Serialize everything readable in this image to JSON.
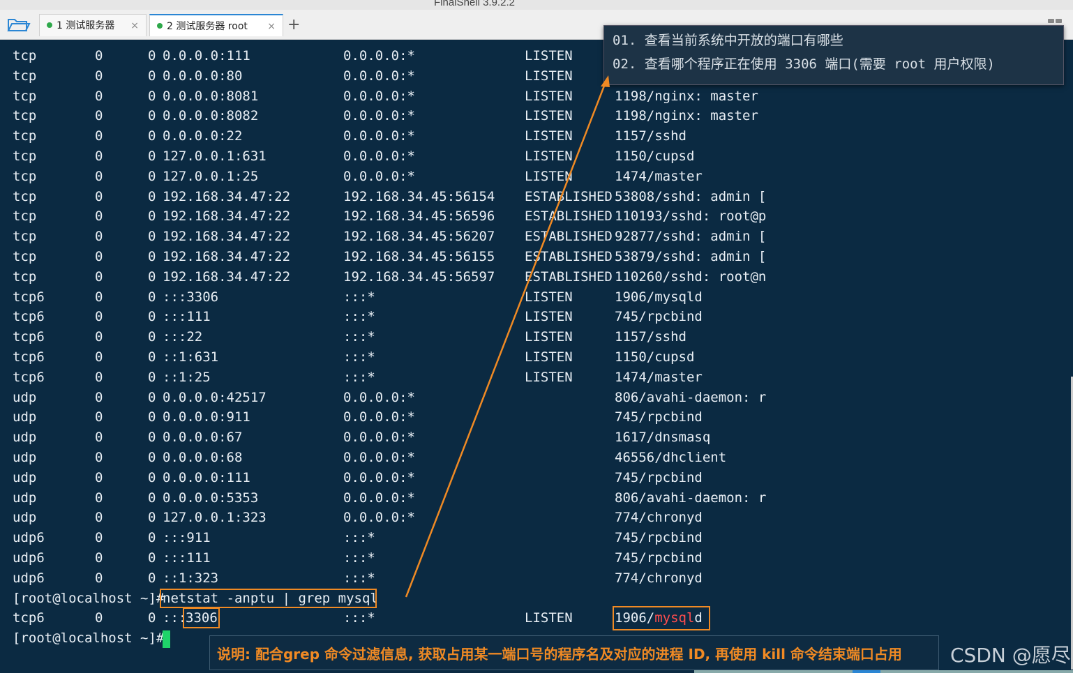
{
  "app": {
    "title": "FinalShell 3.9.2.2"
  },
  "tabs": [
    {
      "label": "1  测试服务器",
      "close": "×"
    },
    {
      "label": "2  测试服务器 root",
      "close": "×"
    }
  ],
  "add_tab": "+",
  "rows": [
    {
      "proto": "tcp",
      "recv": "0",
      "send": "0",
      "local": "0.0.0.0:111",
      "foreign": "0.0.0.0:*",
      "state": "LISTEN",
      "program": ""
    },
    {
      "proto": "tcp",
      "recv": "0",
      "send": "0",
      "local": "0.0.0.0:80",
      "foreign": "0.0.0.0:*",
      "state": "LISTEN",
      "program": ""
    },
    {
      "proto": "tcp",
      "recv": "0",
      "send": "0",
      "local": "0.0.0.0:8081",
      "foreign": "0.0.0.0:*",
      "state": "LISTEN",
      "program": "1198/nginx: master"
    },
    {
      "proto": "tcp",
      "recv": "0",
      "send": "0",
      "local": "0.0.0.0:8082",
      "foreign": "0.0.0.0:*",
      "state": "LISTEN",
      "program": "1198/nginx: master"
    },
    {
      "proto": "tcp",
      "recv": "0",
      "send": "0",
      "local": "0.0.0.0:22",
      "foreign": "0.0.0.0:*",
      "state": "LISTEN",
      "program": "1157/sshd"
    },
    {
      "proto": "tcp",
      "recv": "0",
      "send": "0",
      "local": "127.0.0.1:631",
      "foreign": "0.0.0.0:*",
      "state": "LISTEN",
      "program": "1150/cupsd"
    },
    {
      "proto": "tcp",
      "recv": "0",
      "send": "0",
      "local": "127.0.0.1:25",
      "foreign": "0.0.0.0:*",
      "state": "LISTEN",
      "program": "1474/master"
    },
    {
      "proto": "tcp",
      "recv": "0",
      "send": "0",
      "local": "192.168.34.47:22",
      "foreign": "192.168.34.45:56154",
      "state": "ESTABLISHED",
      "program": "53808/sshd: admin ["
    },
    {
      "proto": "tcp",
      "recv": "0",
      "send": "0",
      "local": "192.168.34.47:22",
      "foreign": "192.168.34.45:56596",
      "state": "ESTABLISHED",
      "program": "110193/sshd: root@p"
    },
    {
      "proto": "tcp",
      "recv": "0",
      "send": "0",
      "local": "192.168.34.47:22",
      "foreign": "192.168.34.45:56207",
      "state": "ESTABLISHED",
      "program": "92877/sshd: admin ["
    },
    {
      "proto": "tcp",
      "recv": "0",
      "send": "0",
      "local": "192.168.34.47:22",
      "foreign": "192.168.34.45:56155",
      "state": "ESTABLISHED",
      "program": "53879/sshd: admin ["
    },
    {
      "proto": "tcp",
      "recv": "0",
      "send": "0",
      "local": "192.168.34.47:22",
      "foreign": "192.168.34.45:56597",
      "state": "ESTABLISHED",
      "program": "110260/sshd: root@n"
    },
    {
      "proto": "tcp6",
      "recv": "0",
      "send": "0",
      "local": ":::3306",
      "foreign": ":::*",
      "state": "LISTEN",
      "program": "1906/mysqld"
    },
    {
      "proto": "tcp6",
      "recv": "0",
      "send": "0",
      "local": ":::111",
      "foreign": ":::*",
      "state": "LISTEN",
      "program": "745/rpcbind"
    },
    {
      "proto": "tcp6",
      "recv": "0",
      "send": "0",
      "local": ":::22",
      "foreign": ":::*",
      "state": "LISTEN",
      "program": "1157/sshd"
    },
    {
      "proto": "tcp6",
      "recv": "0",
      "send": "0",
      "local": "::1:631",
      "foreign": ":::*",
      "state": "LISTEN",
      "program": "1150/cupsd"
    },
    {
      "proto": "tcp6",
      "recv": "0",
      "send": "0",
      "local": "::1:25",
      "foreign": ":::*",
      "state": "LISTEN",
      "program": "1474/master"
    },
    {
      "proto": "udp",
      "recv": "0",
      "send": "0",
      "local": "0.0.0.0:42517",
      "foreign": "0.0.0.0:*",
      "state": "",
      "program": "806/avahi-daemon: r"
    },
    {
      "proto": "udp",
      "recv": "0",
      "send": "0",
      "local": "0.0.0.0:911",
      "foreign": "0.0.0.0:*",
      "state": "",
      "program": "745/rpcbind"
    },
    {
      "proto": "udp",
      "recv": "0",
      "send": "0",
      "local": "0.0.0.0:67",
      "foreign": "0.0.0.0:*",
      "state": "",
      "program": "1617/dnsmasq"
    },
    {
      "proto": "udp",
      "recv": "0",
      "send": "0",
      "local": "0.0.0.0:68",
      "foreign": "0.0.0.0:*",
      "state": "",
      "program": "46556/dhclient"
    },
    {
      "proto": "udp",
      "recv": "0",
      "send": "0",
      "local": "0.0.0.0:111",
      "foreign": "0.0.0.0:*",
      "state": "",
      "program": "745/rpcbind"
    },
    {
      "proto": "udp",
      "recv": "0",
      "send": "0",
      "local": "0.0.0.0:5353",
      "foreign": "0.0.0.0:*",
      "state": "",
      "program": "806/avahi-daemon: r"
    },
    {
      "proto": "udp",
      "recv": "0",
      "send": "0",
      "local": "127.0.0.1:323",
      "foreign": "0.0.0.0:*",
      "state": "",
      "program": "774/chronyd"
    },
    {
      "proto": "udp6",
      "recv": "0",
      "send": "0",
      "local": ":::911",
      "foreign": ":::*",
      "state": "",
      "program": "745/rpcbind"
    },
    {
      "proto": "udp6",
      "recv": "0",
      "send": "0",
      "local": ":::111",
      "foreign": ":::*",
      "state": "",
      "program": "745/rpcbind"
    },
    {
      "proto": "udp6",
      "recv": "0",
      "send": "0",
      "local": "::1:323",
      "foreign": ":::*",
      "state": "",
      "program": "774/chronyd"
    }
  ],
  "command": {
    "prompt": "[root@localhost ~]#",
    "text": "netstat -anptu | grep mysql"
  },
  "result": {
    "proto": "tcp6",
    "recv": "0",
    "send": "0",
    "local_prefix": ":::",
    "local_port": "3306",
    "foreign": ":::*",
    "state": "LISTEN",
    "program_prefix": "1906/",
    "program_match": "mysql",
    "program_suffix": "d"
  },
  "prompt_final": "[root@localhost ~]#",
  "callout": {
    "line1": "01. 查看当前系统中开放的端口有哪些",
    "line2": "02. 查看哪个程序正在使用 3306 端口(需要 root 用户权限)"
  },
  "note": "说明: 配合grep 命令过滤信息, 获取占用某一端口号的程序名及对应的进程 ID, 再使用 kill 命令结束端口占用",
  "watermark": "CSDN @愿尽",
  "colors": {
    "terminal_bg": "#0b2a42",
    "terminal_fg": "#e8eef4",
    "highlight": "#f08a24",
    "match": "#ff4d4d",
    "cursor": "#1fd36a"
  }
}
